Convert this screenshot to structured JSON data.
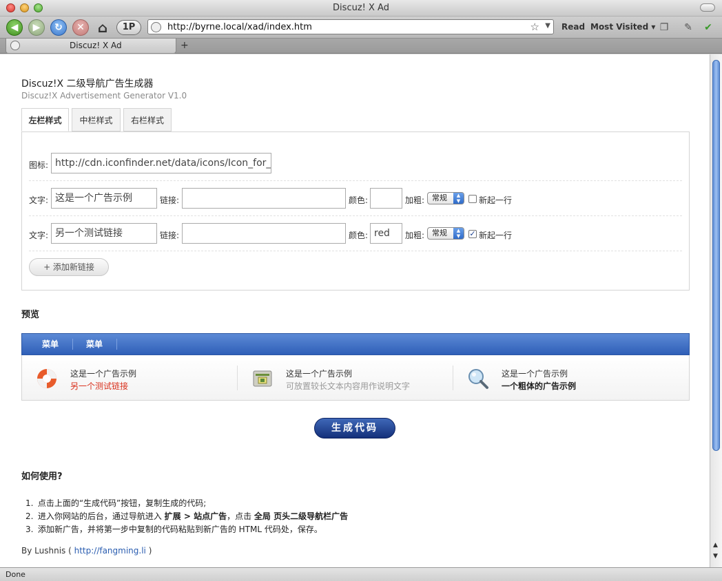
{
  "window": {
    "title": "Discuz! X Ad"
  },
  "toolbar": {
    "one_p": "1P",
    "url": "http://byrne.local/xad/index.htm",
    "read": "Read",
    "most_visited": "Most Visited ▾"
  },
  "browser_tab": {
    "label": "Discuz! X Ad",
    "new_tab": "+"
  },
  "status": {
    "text": "Done"
  },
  "page": {
    "title": "Discuz!X 二级导航广告生成器",
    "subtitle": "Discuz!X Advertisement Generator V1.0",
    "tabs": [
      {
        "label": "左栏样式"
      },
      {
        "label": "中栏样式"
      },
      {
        "label": "右栏样式"
      }
    ],
    "form": {
      "icon_label": "图标:",
      "icon_value": "http://cdn.iconfinder.net/data/icons/Icon_for_",
      "rows": [
        {
          "text_label": "文字:",
          "text_value": "这是一个广告示例",
          "link_label": "链接:",
          "link_value": "",
          "color_label": "颜色:",
          "color_value": "",
          "bold_label": "加粗:",
          "bold_value": "常规",
          "newline_label": "新起一行",
          "newline_checked": ""
        },
        {
          "text_label": "文字:",
          "text_value": "另一个测试链接",
          "link_label": "链接:",
          "link_value": "",
          "color_label": "颜色:",
          "color_value": "red",
          "bold_label": "加粗:",
          "bold_value": "常规",
          "newline_label": "新起一行",
          "newline_checked": "✓"
        }
      ],
      "add_link": "+ 添加新链接"
    },
    "preview": {
      "heading": "预览",
      "nav": [
        "菜单",
        "菜单"
      ],
      "cells": [
        {
          "icon": "lifebuoy-icon",
          "title": "这是一个广告示例",
          "sub": "另一个测试链接",
          "sub_color": "#d9301c"
        },
        {
          "icon": "ticket-icon",
          "title": "这是一个广告示例",
          "sub": "可放置较长文本内容用作说明文字",
          "sub_color": "#999999"
        },
        {
          "icon": "magnifier-icon",
          "title": "这是一个广告示例",
          "sub": "一个粗体的广告示例",
          "sub_color": "#222222"
        }
      ],
      "nav_color": "#3a68c2"
    },
    "generate": "生成代码",
    "howto": {
      "heading": "如何使用?",
      "steps": [
        {
          "num": "1.",
          "text": "点击上面的“生成代码”按钮，复制生成的代码;"
        },
        {
          "num": "2.",
          "a": "进入你网站的后台，通过导航进入 ",
          "b": "扩展 > 站点广告",
          "c": "，点击 ",
          "d": "全局 页头二级导航栏广告"
        },
        {
          "num": "3.",
          "text": "添加新广告，并将第一步中复制的代码粘贴到新广告的 HTML 代码处，保存。"
        }
      ]
    },
    "credit": {
      "prefix": "By Lushnis ( ",
      "link": "http://fangming.li",
      "suffix": " )"
    }
  }
}
